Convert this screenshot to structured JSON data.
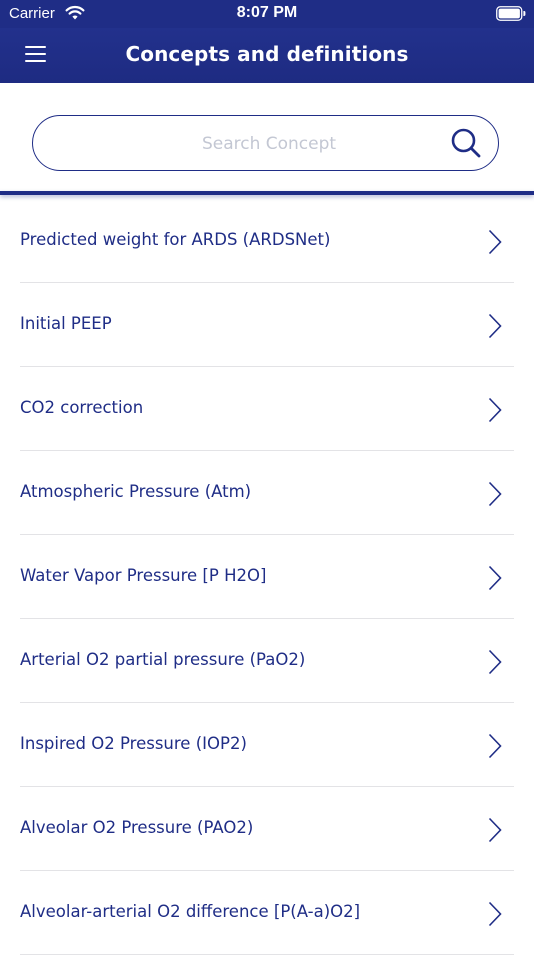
{
  "status_bar": {
    "carrier": "Carrier",
    "time": "8:07 PM",
    "wifi_icon": "wifi-icon",
    "battery_icon": "battery-icon"
  },
  "nav_bar": {
    "title": "Concepts and definitions",
    "menu_icon": "hamburger-menu-icon",
    "background_color": "#1f2d86"
  },
  "search": {
    "placeholder": "Search Concept",
    "value": "",
    "icon": "search-icon"
  },
  "concepts": [
    {
      "label": "Predicted weight for ARDS (ARDSNet)"
    },
    {
      "label": "Initial PEEP"
    },
    {
      "label": "CO2 correction"
    },
    {
      "label": "Atmospheric Pressure (Atm)"
    },
    {
      "label": "Water Vapor Pressure [P H2O]"
    },
    {
      "label": "Arterial O2 partial pressure (PaO2)"
    },
    {
      "label": "Inspired O2 Pressure (IOP2)"
    },
    {
      "label": "Alveolar O2 Pressure (PAO2)"
    },
    {
      "label": "Alveolar-arterial O2 difference [P(A-a)O2]"
    }
  ],
  "colors": {
    "accent": "#1f2d86",
    "text": "#1f2d86",
    "placeholder": "#c3c7d3",
    "separator": "#e3e3e6"
  }
}
